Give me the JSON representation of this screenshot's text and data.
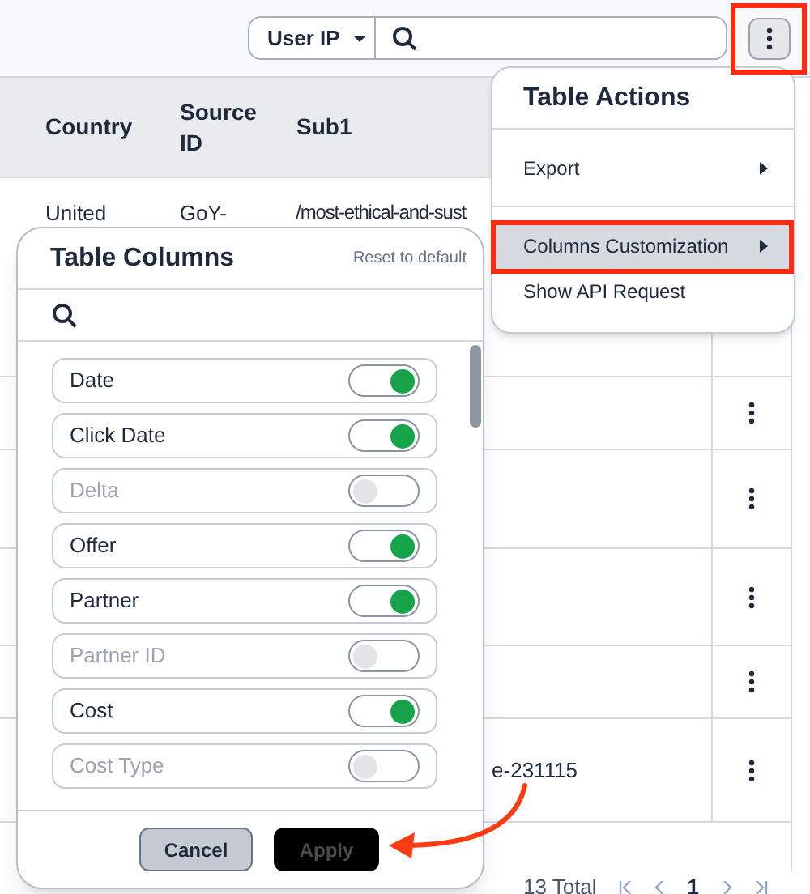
{
  "toolbar": {
    "filter_select": "User IP"
  },
  "table": {
    "columns": [
      "Country",
      "Source ID",
      "Sub1"
    ],
    "rows": [
      {
        "country": "United",
        "source_id": "GoY-",
        "sub1": "/most-ethical-and-sust",
        "sub1_clipped": false
      },
      {
        "action_menu": true
      },
      {
        "action_menu": true
      },
      {
        "action_menu": true
      },
      {
        "action_menu": true
      },
      {
        "sub1": "e-231115",
        "sub1_clipped": true,
        "action_menu": true
      }
    ]
  },
  "pagination": {
    "total": "13 Total",
    "page": "1"
  },
  "table_actions": {
    "title": "Table Actions",
    "items": [
      {
        "label": "Export",
        "submenu": true,
        "selected": false
      },
      {
        "label": "Columns Customization",
        "submenu": true,
        "selected": true
      },
      {
        "label": "Show API Request",
        "submenu": false,
        "selected": false
      }
    ]
  },
  "table_columns": {
    "title": "Table Columns",
    "reset": "Reset to default",
    "columns": [
      {
        "label": "Date",
        "on": true
      },
      {
        "label": "Click Date",
        "on": true
      },
      {
        "label": "Delta",
        "on": false
      },
      {
        "label": "Offer",
        "on": true
      },
      {
        "label": "Partner",
        "on": true
      },
      {
        "label": "Partner ID",
        "on": false
      },
      {
        "label": "Cost",
        "on": true
      },
      {
        "label": "Cost Type",
        "on": false
      }
    ],
    "buttons": [
      {
        "label": "Cancel",
        "kind": "secondary",
        "disabled": false
      },
      {
        "label": "Apply",
        "kind": "primary",
        "disabled": true
      }
    ]
  }
}
